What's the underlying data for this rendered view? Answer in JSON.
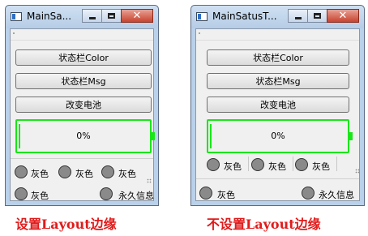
{
  "left_window": {
    "title": "MainSa...",
    "buttons": [
      "状态栏Color",
      "状态栏Msg",
      "改变电池"
    ],
    "battery_text": "0%",
    "status_row1": [
      "灰色",
      "灰色",
      "灰色"
    ],
    "status_row2_left": "灰色",
    "status_row2_right": "永久信息"
  },
  "right_window": {
    "title": "MainSatusT...",
    "buttons": [
      "状态栏Color",
      "状态栏Msg",
      "改变电池"
    ],
    "battery_text": "0%",
    "status_row1": [
      "灰色",
      "灰色",
      "灰色"
    ],
    "status_row2_left": "灰色",
    "status_row2_right": "永久信息"
  },
  "captions": {
    "left": "设置Layout边缘",
    "right": "不设置Layout边缘"
  },
  "colors": {
    "caption": "#e11b1b",
    "battery": "#19e619",
    "indicator": "#8a8a8a"
  },
  "icons": {
    "close": "✕"
  }
}
